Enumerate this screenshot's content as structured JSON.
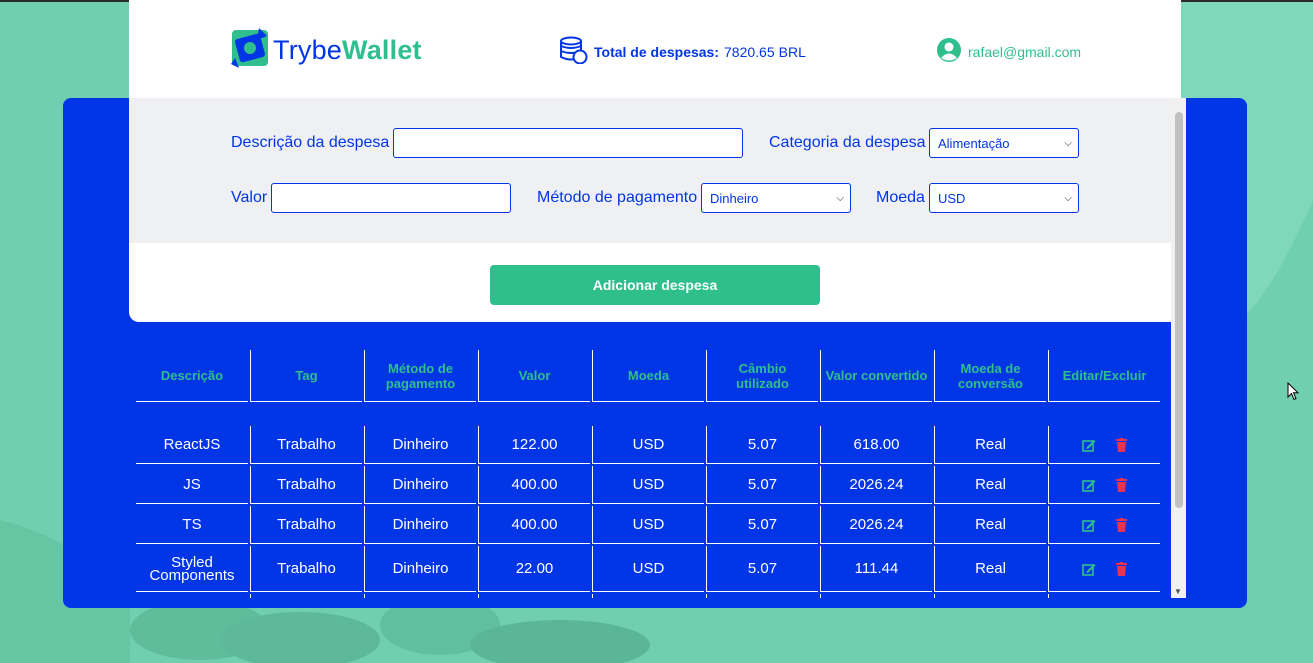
{
  "header": {
    "logo_part1": "Trybe",
    "logo_part2": "Wallet",
    "total_label": "Total de despesas:",
    "total_value": "7820.65",
    "total_currency": "BRL",
    "email": "rafael@gmail.com"
  },
  "form": {
    "description_label": "Descrição da despesa",
    "description_value": "",
    "category_label": "Categoria da despesa",
    "category_selected": "Alimentação",
    "value_label": "Valor",
    "value_value": "",
    "payment_label": "Método de pagamento",
    "payment_selected": "Dinheiro",
    "currency_label": "Moeda",
    "currency_selected": "USD",
    "submit_label": "Adicionar despesa"
  },
  "table": {
    "headers": [
      "Descrição",
      "Tag",
      "Método de pagamento",
      "Valor",
      "Moeda",
      "Câmbio utilizado",
      "Valor convertido",
      "Moeda de conversão",
      "Editar/Excluir"
    ],
    "rows": [
      {
        "descricao": "ReactJS",
        "tag": "Trabalho",
        "metodo": "Dinheiro",
        "valor": "122.00",
        "moeda": "USD",
        "cambio": "5.07",
        "convertido": "618.00",
        "conversao": "Real"
      },
      {
        "descricao": "JS",
        "tag": "Trabalho",
        "metodo": "Dinheiro",
        "valor": "400.00",
        "moeda": "USD",
        "cambio": "5.07",
        "convertido": "2026.24",
        "conversao": "Real"
      },
      {
        "descricao": "TS",
        "tag": "Trabalho",
        "metodo": "Dinheiro",
        "valor": "400.00",
        "moeda": "USD",
        "cambio": "5.07",
        "convertido": "2026.24",
        "conversao": "Real"
      },
      {
        "descricao": "Styled Components",
        "tag": "Trabalho",
        "metodo": "Dinheiro",
        "valor": "22.00",
        "moeda": "USD",
        "cambio": "5.07",
        "convertido": "111.44",
        "conversao": "Real"
      }
    ]
  },
  "colors": {
    "brand_blue": "#0235e6",
    "brand_green": "#2fbf8c",
    "delete_red": "#e8344e"
  },
  "icons": [
    "trybewallet-logo-icon",
    "coins-icon",
    "user-avatar-icon",
    "edit-icon",
    "trash-icon"
  ]
}
